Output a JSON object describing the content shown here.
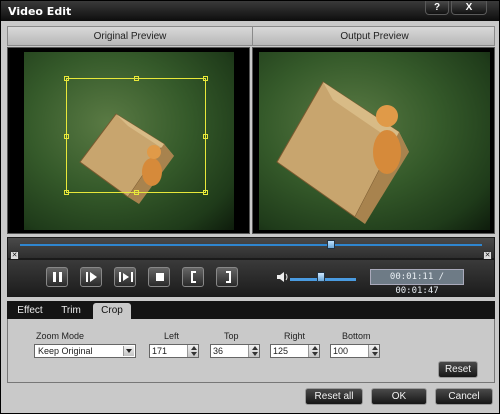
{
  "window": {
    "title": "Video Edit",
    "help_label": "?",
    "close_label": "X"
  },
  "preview": {
    "original_label": "Original Preview",
    "output_label": "Output Preview"
  },
  "playback": {
    "time": "00:01:11 / 00:01:47",
    "position_fraction": 0.67,
    "volume_fraction": 0.45
  },
  "tabs": [
    {
      "label": "Effect",
      "active": false
    },
    {
      "label": "Trim",
      "active": false
    },
    {
      "label": "Crop",
      "active": true
    }
  ],
  "crop": {
    "zoom_mode_label": "Zoom Mode",
    "zoom_mode_value": "Keep Original",
    "left_label": "Left",
    "left_value": "171",
    "top_label": "Top",
    "top_value": "36",
    "right_label": "Right",
    "right_value": "125",
    "bottom_label": "Bottom",
    "bottom_value": "100",
    "reset_label": "Reset"
  },
  "footer": {
    "reset_all_label": "Reset all",
    "ok_label": "OK",
    "cancel_label": "Cancel"
  },
  "colors": {
    "accent": "#2f86d0",
    "crop_box": "#e8e83a"
  }
}
